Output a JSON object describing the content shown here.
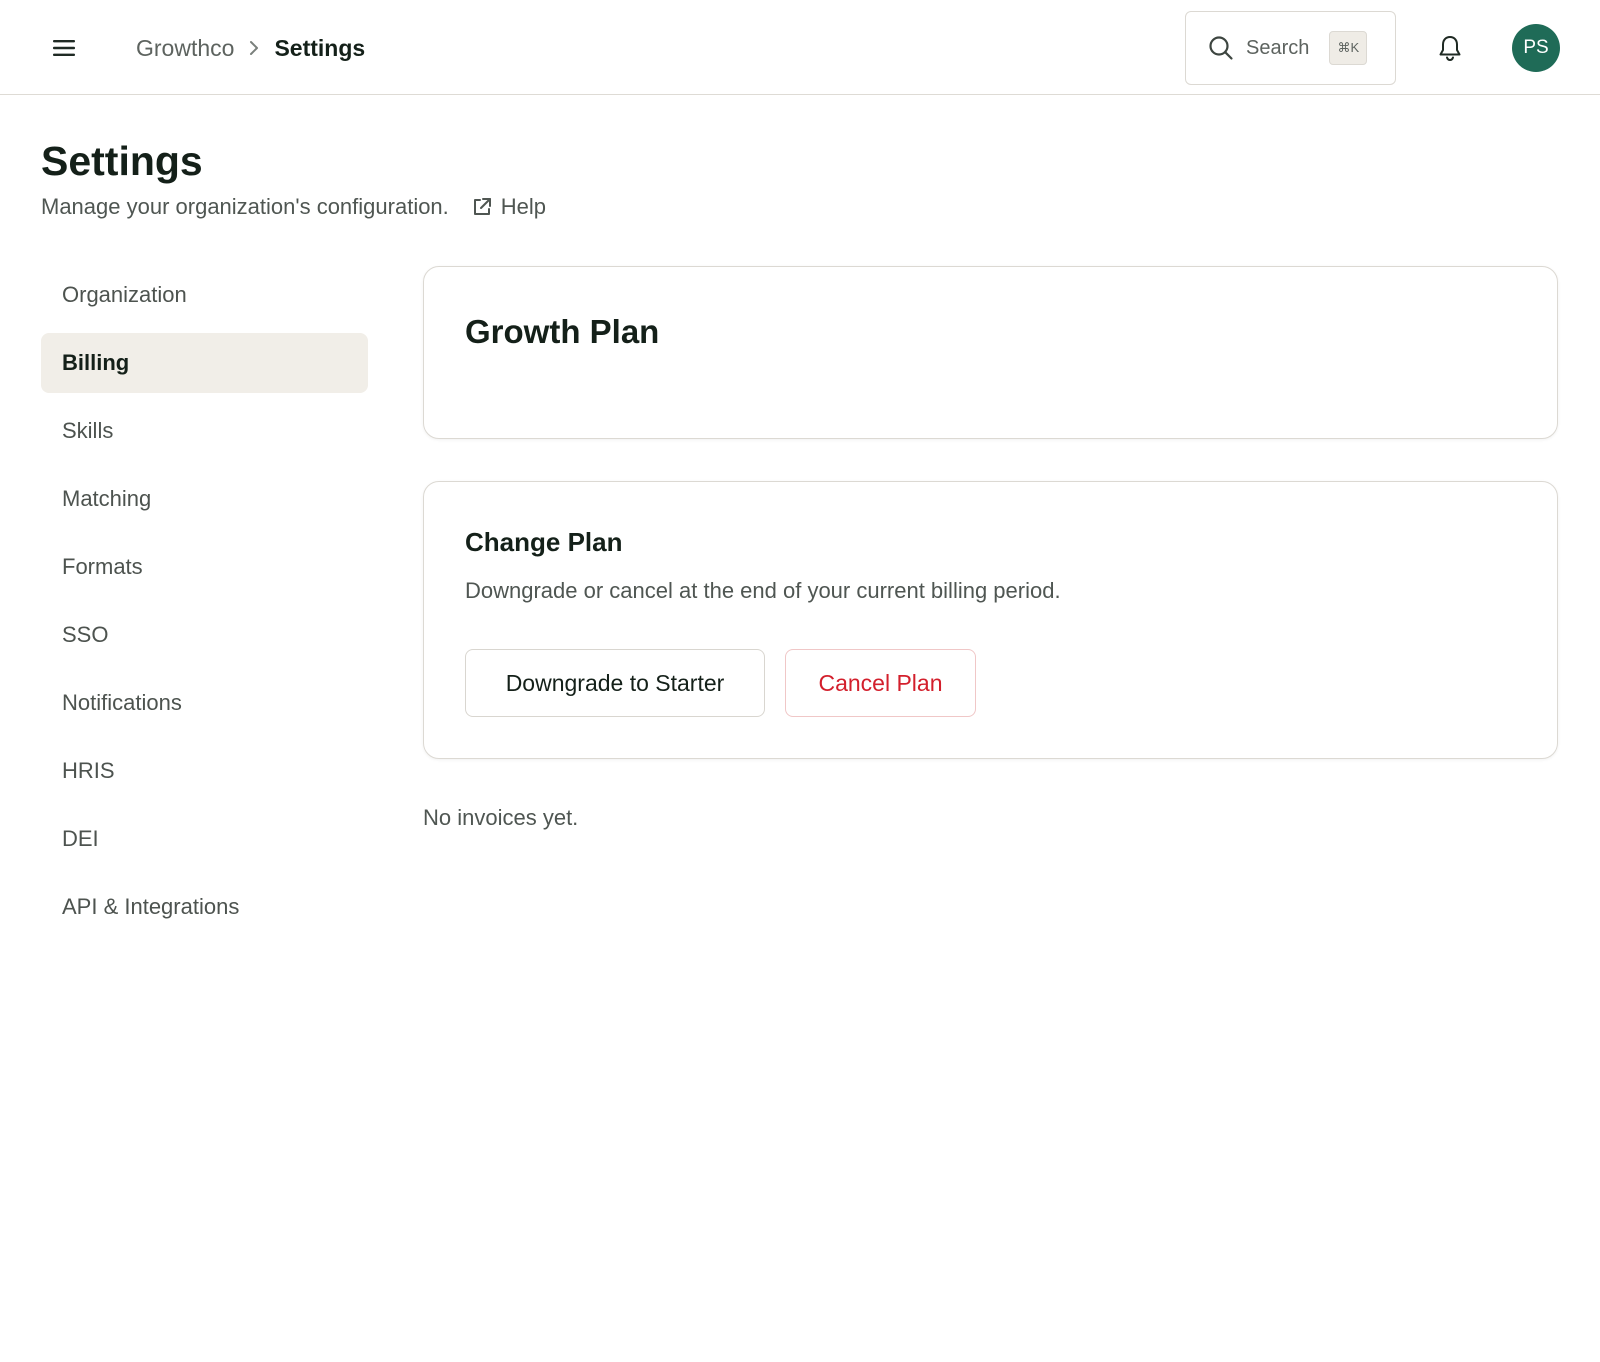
{
  "header": {
    "menu_icon": "hamburger-menu-icon",
    "breadcrumb": {
      "org": "Growthco",
      "separator_icon": "chevron-right-icon",
      "current": "Settings"
    },
    "search": {
      "icon": "search-icon",
      "label": "Search",
      "shortcut": "⌘K"
    },
    "notifications_icon": "bell-icon",
    "avatar": {
      "initials": "PS",
      "color": "#1f6b57"
    }
  },
  "page": {
    "title": "Settings",
    "subtitle": "Manage your organization's configuration.",
    "help_label": "Help",
    "help_icon": "external-link-icon"
  },
  "sidebar": {
    "active": "Billing",
    "items": [
      {
        "label": "Organization"
      },
      {
        "label": "Billing"
      },
      {
        "label": "Skills"
      },
      {
        "label": "Matching"
      },
      {
        "label": "Formats"
      },
      {
        "label": "SSO"
      },
      {
        "label": "Notifications"
      },
      {
        "label": "HRIS"
      },
      {
        "label": "DEI"
      },
      {
        "label": "API & Integrations"
      }
    ]
  },
  "billing": {
    "plan_title": "Growth Plan",
    "change_plan": {
      "title": "Change Plan",
      "description": "Downgrade or cancel at the end of your current billing period.",
      "downgrade_label": "Downgrade to Starter",
      "cancel_label": "Cancel Plan"
    },
    "invoices_empty": "No invoices yet."
  },
  "colors": {
    "accent": "#1f6b57",
    "danger": "#d31f2c",
    "active_nav_bg": "#f1eee8",
    "border": "#dcd9d3"
  }
}
